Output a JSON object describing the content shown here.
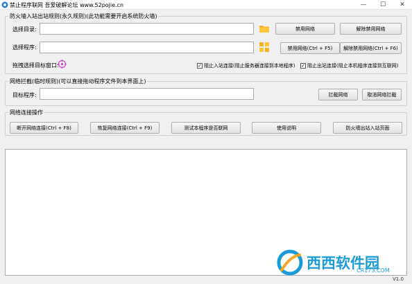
{
  "window": {
    "title": "禁止程序联网 吾爱破解论坛 www.52pojie.cn",
    "controls": {
      "minimize": "—",
      "maximize": "☐",
      "close": "✕"
    }
  },
  "firewall_group": {
    "title": "防火墙入站出站规则(永久规则)(此功能需要开启系统防火墙)",
    "select_dir_label": "选择目录:",
    "select_dir_value": "",
    "disable_net_btn": "禁用网络",
    "undo_disable_btn": "解除禁用网络",
    "select_prog_label": "选择程序:",
    "select_prog_value": "",
    "disable_net_hotkey_btn": "禁用网络(Ctrl + F5)",
    "undo_disable_hotkey_btn": "解除禁用网络(Ctrl + F6)",
    "drag_select_label": "拖拽选择目标窗口:",
    "block_inbound": {
      "label": "阻止入站连接(阻止服务器连接到本地程序)",
      "checked": true
    },
    "block_outbound": {
      "label": "阻止出站连接(阻止本机程序连接到互联网)",
      "checked": true
    }
  },
  "intercept_group": {
    "title": "网络拦截(临时规则)(可以直接拖动程序文件到本界面上)",
    "target_label": "目标程序:",
    "target_value": "",
    "intercept_btn": "拦截网络",
    "cancel_intercept_btn": "取消网络拦截"
  },
  "ops_group": {
    "title": "网络连接操作",
    "buttons": [
      "断开网络连接(Ctrl + F8)",
      "恢复网络连接(Ctrl + F9)",
      "测试本程序是否联网",
      "使用说明",
      "防火墙出站入站页面"
    ]
  },
  "log": {
    "content": ""
  },
  "watermark": {
    "text": "西西软件园",
    "sub": "CR173.COM"
  },
  "version": "V1.0",
  "colors": {
    "folder": "#f5b324",
    "accent": "#1b9ad8",
    "crosshair": "#cc44cc"
  }
}
